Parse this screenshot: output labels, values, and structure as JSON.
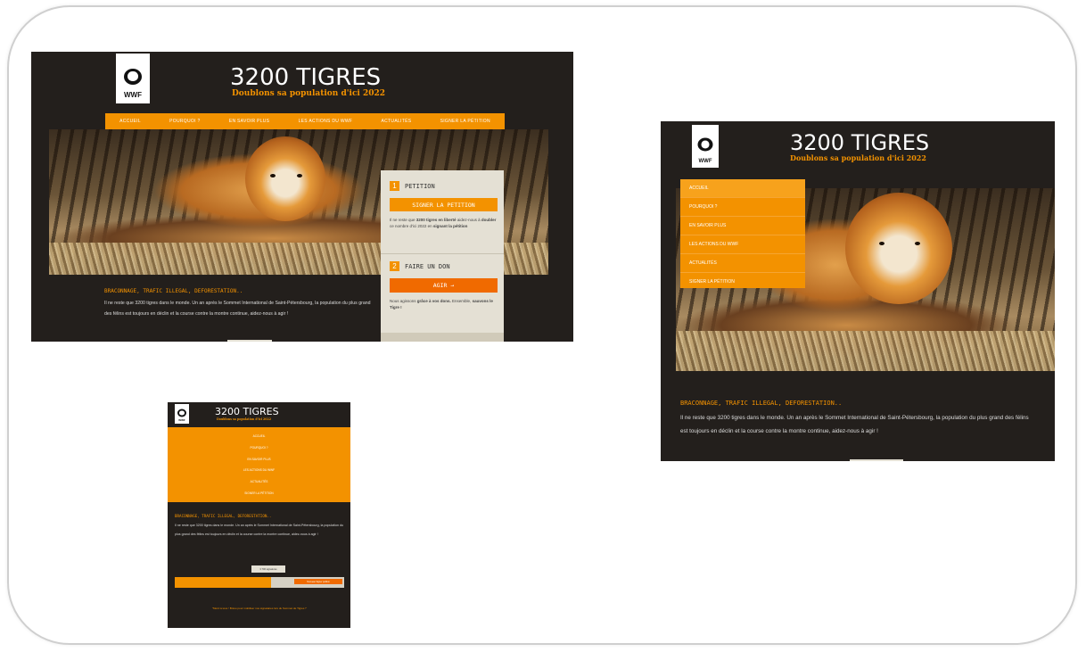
{
  "brand": {
    "logo_text": "WWF",
    "title": "3200 TIGRES",
    "subtitle": "Doublons sa population d'ici 2022"
  },
  "nav": [
    "Accueil",
    "Pourquoi ?",
    "En savoir plus",
    "Les actions du WWF",
    "Actualités",
    "Signer la pétition"
  ],
  "article": {
    "heading": "BRACONNAGE, TRAFIC ILLEGAL, DEFORESTATION..",
    "body": "Il ne reste que 3200 tigres dans le monde. Un an après le Sommet International de Saint-Pétersbourg, la population du plus grand des félins est toujours en déclin et la course contre la montre continue, aidez-nous à agir !"
  },
  "petition": {
    "num": "1",
    "title": "PETITION",
    "button": "SIGNER LA PETITION",
    "text_pre": "Il ne reste que ",
    "text_b1": "3200 tigres en liberté",
    "text_mid1": " aidez-nous à ",
    "text_b2": "doubler",
    "text_mid2": " ce nombre d'ici 2022 en ",
    "text_b3": "signant la pétition"
  },
  "donation": {
    "num": "2",
    "title": "FAIRE UN DON",
    "button": "AGIR →",
    "text_pre": "Nous agissons ",
    "text_b1": "grâce à vos dons.",
    "text_mid": " Ensemble, ",
    "text_b2": "sauvons le Tigre !"
  },
  "mobile": {
    "button_small": "3 700 signatures",
    "bar_label": "Nouveau Signer pétition",
    "quote": "\"Merci à tous ! Bravo pour mobiliser nos signataires lors du Sommet de Tigres !\""
  }
}
